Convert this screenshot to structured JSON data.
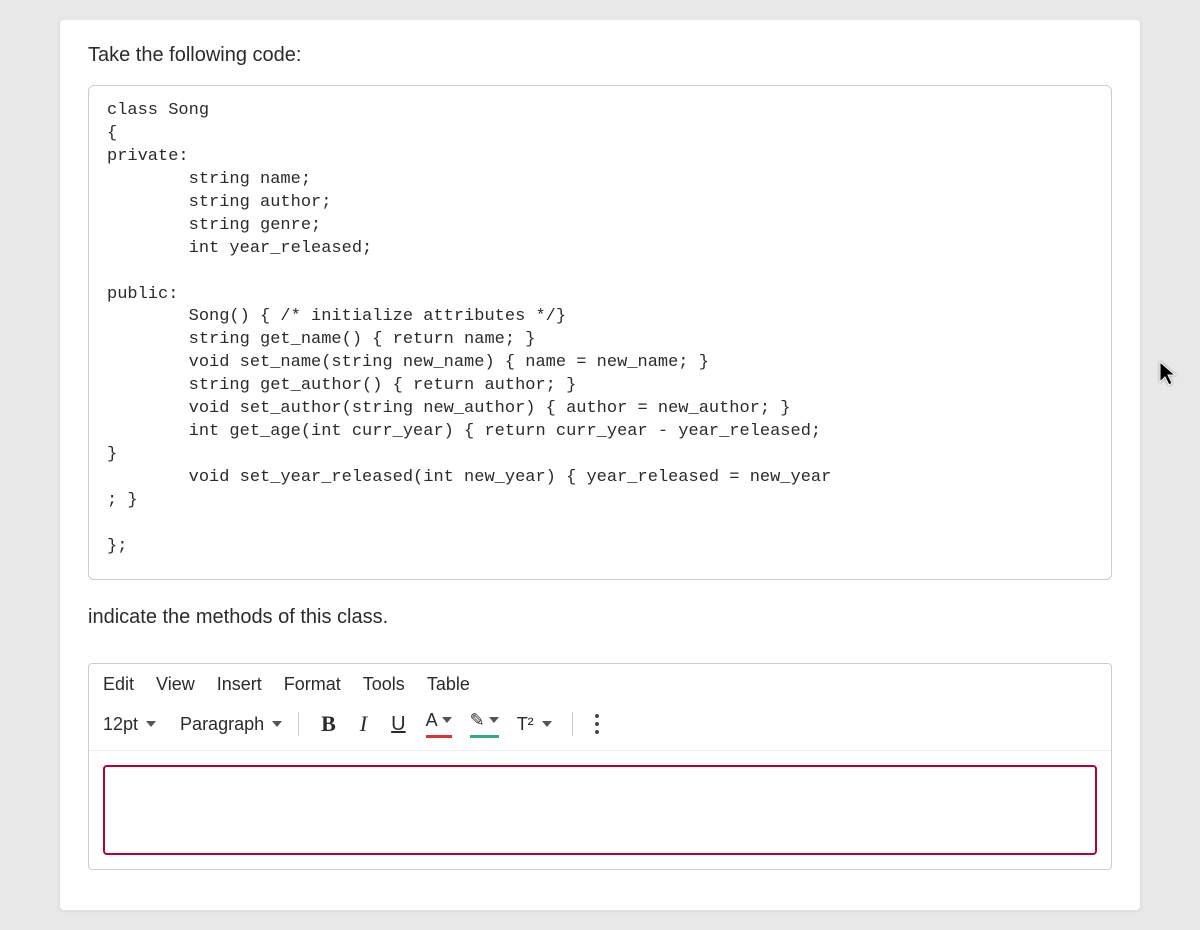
{
  "prompt": "Take the following code:",
  "code": "class Song\n{\nprivate:\n        string name;\n        string author;\n        string genre;\n        int year_released;\n\npublic:\n        Song() { /* initialize attributes */}\n        string get_name() { return name; }\n        void set_name(string new_name) { name = new_name; }\n        string get_author() { return author; }\n        void set_author(string new_author) { author = new_author; }\n        int get_age(int curr_year) { return curr_year - year_released;\n}\n        void set_year_released(int new_year) { year_released = new_year\n; }\n\n};",
  "instruction": "indicate the methods of this class.",
  "editor": {
    "menu": {
      "edit": "Edit",
      "view": "View",
      "insert": "Insert",
      "format": "Format",
      "tools": "Tools",
      "table": "Table"
    },
    "toolbar": {
      "font_size": "12pt",
      "block_format": "Paragraph",
      "bold": "B",
      "italic": "I",
      "underline": "U",
      "text_color_letter": "A",
      "highlight_glyph": "✎",
      "superscript": "T²"
    }
  }
}
